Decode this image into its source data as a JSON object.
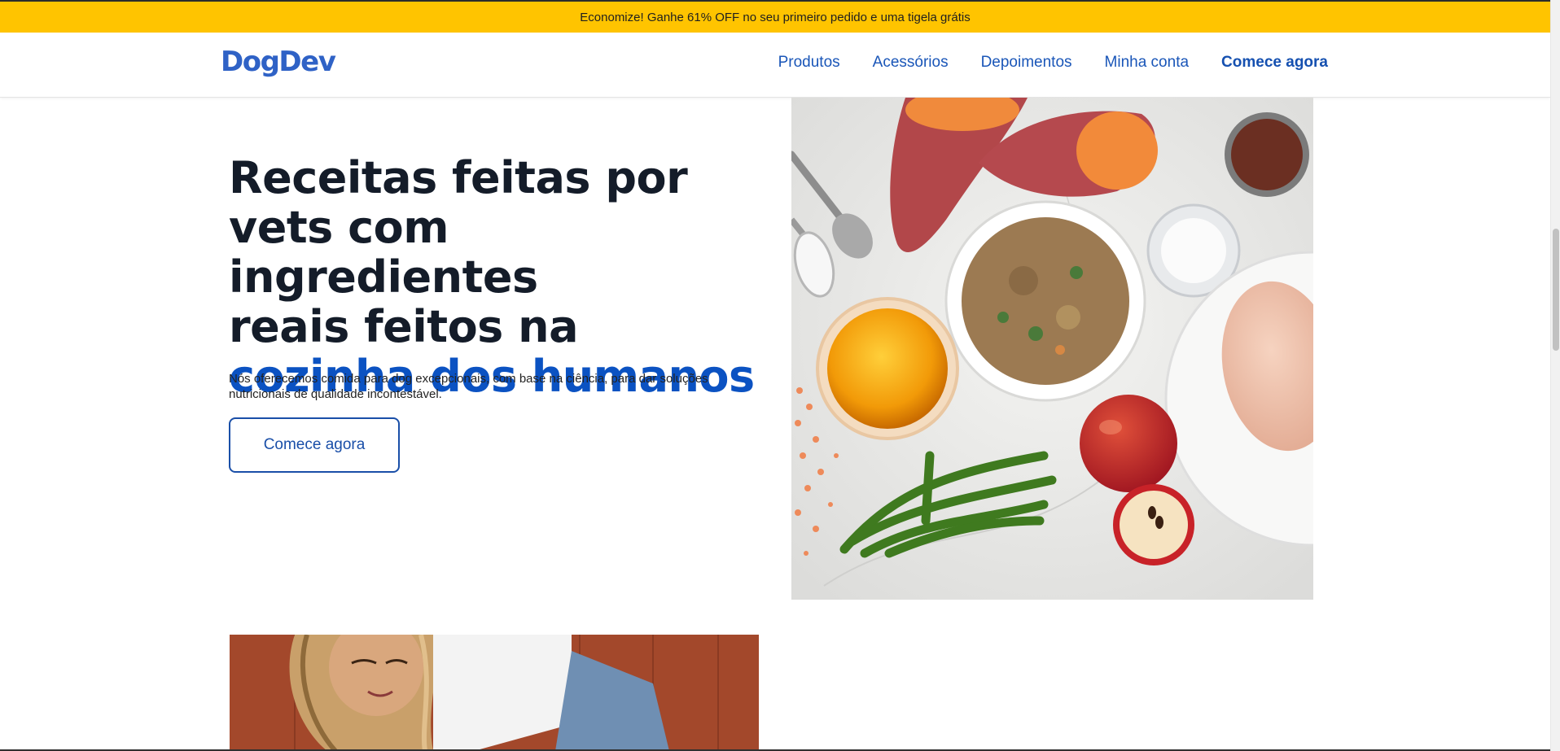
{
  "promo": {
    "text": "Economize! Ganhe 61% OFF no seu primeiro pedido e uma tigela grátis"
  },
  "header": {
    "logo": "DogDev",
    "nav": [
      {
        "label": "Produtos"
      },
      {
        "label": "Acessórios"
      },
      {
        "label": "Depoimentos"
      },
      {
        "label": "Minha conta"
      },
      {
        "label": "Comece agora"
      }
    ]
  },
  "hero": {
    "title_line1": "Receitas feitas por",
    "title_line2": "vets com ingredientes",
    "title_line3": "reais feitos na",
    "title_accent": "cozinha dos humanos",
    "description": "Nós oferecemos comida para dog excepcionais, com base na ciência, para dar soluções nutricionais de qualidade incontestável.",
    "button_label": "Comece agora"
  },
  "colors": {
    "promo_bg": "#ffc400",
    "brand_blue": "#2f62c6",
    "accent_blue": "#0b52c2",
    "title_dark": "#141c29"
  }
}
